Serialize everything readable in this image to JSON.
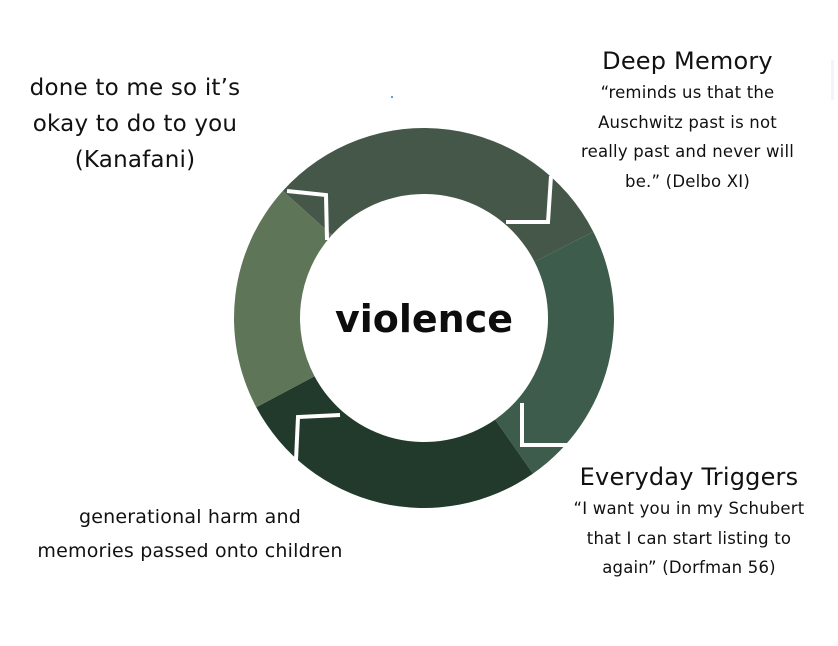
{
  "diagram": {
    "center_label": "violence",
    "colors": {
      "segment_top": "#455749",
      "segment_right": "#3e5c4b",
      "segment_bottom": "#223a2b",
      "segment_left": "#5f7558",
      "separator": "#ffffff"
    }
  },
  "labels": {
    "left": {
      "lines": [
        "done to me so it’s",
        "okay to do to you",
        "(Kanafani)"
      ]
    },
    "top_right": {
      "heading": "Deep Memory",
      "quote_lines": [
        "“reminds us that the",
        "Auschwitz past is not",
        "really past and never will",
        "be.” (Delbo XI)"
      ]
    },
    "bottom_right": {
      "heading": "Everyday Triggers",
      "quote_lines": [
        "“I want you in my Schubert",
        "that I can start listing to",
        "again” (Dorfman 56)"
      ]
    },
    "bottom_left": {
      "lines": [
        "generational harm and",
        "memories passed onto children"
      ]
    }
  }
}
